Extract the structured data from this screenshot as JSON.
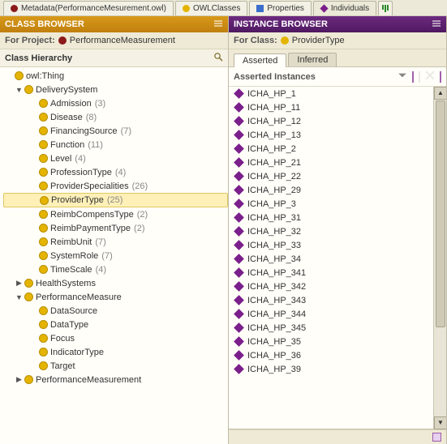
{
  "tabs": {
    "metadata": "Metadata(PerformanceMesurement.owl)",
    "owl": "OWLClasses",
    "props": "Properties",
    "indiv": "Individuals"
  },
  "left": {
    "header": "CLASS BROWSER",
    "for_project_lbl": "For Project:",
    "project": "PerformanceMeasurement",
    "section": "Class Hierarchy",
    "root": "owl:Thing",
    "nodes": [
      {
        "name": "DeliverySystem",
        "open": true,
        "children": [
          {
            "name": "Admission",
            "count": 3
          },
          {
            "name": "Disease",
            "count": 8
          },
          {
            "name": "FinancingSource",
            "count": 7
          },
          {
            "name": "Function",
            "count": 11
          },
          {
            "name": "Level",
            "count": 4
          },
          {
            "name": "ProfessionType",
            "count": 4
          },
          {
            "name": "ProviderSpecialities",
            "count": 26
          },
          {
            "name": "ProviderType",
            "count": 25,
            "selected": true
          },
          {
            "name": "ReimbCompensType",
            "count": 2
          },
          {
            "name": "ReimbPaymentType",
            "count": 2
          },
          {
            "name": "ReimbUnit",
            "count": 7
          },
          {
            "name": "SystemRole",
            "count": 7
          },
          {
            "name": "TimeScale",
            "count": 4
          }
        ]
      },
      {
        "name": "HealthSystems",
        "open": false
      },
      {
        "name": "PerformanceMeasure",
        "open": true,
        "children": [
          {
            "name": "DataSource"
          },
          {
            "name": "DataType"
          },
          {
            "name": "Focus"
          },
          {
            "name": "IndicatorType"
          },
          {
            "name": "Target"
          }
        ]
      },
      {
        "name": "PerformanceMeasurement",
        "open": false
      }
    ]
  },
  "right": {
    "header": "INSTANCE BROWSER",
    "for_class_lbl": "For Class:",
    "class": "ProviderType",
    "tabs": {
      "asserted": "Asserted",
      "inferred": "Inferred"
    },
    "list_title": "Asserted Instances",
    "instances": [
      "ICHA_HP_1",
      "ICHA_HP_11",
      "ICHA_HP_12",
      "ICHA_HP_13",
      "ICHA_HP_2",
      "ICHA_HP_21",
      "ICHA_HP_22",
      "ICHA_HP_29",
      "ICHA_HP_3",
      "ICHA_HP_31",
      "ICHA_HP_32",
      "ICHA_HP_33",
      "ICHA_HP_34",
      "ICHA_HP_341",
      "ICHA_HP_342",
      "ICHA_HP_343",
      "ICHA_HP_344",
      "ICHA_HP_345",
      "ICHA_HP_35",
      "ICHA_HP_36",
      "ICHA_HP_39"
    ]
  }
}
